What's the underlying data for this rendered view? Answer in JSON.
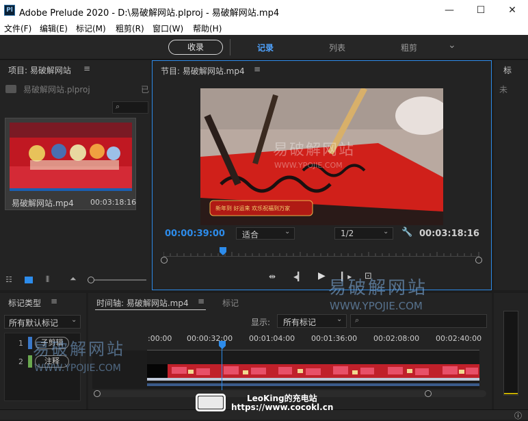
{
  "window": {
    "icon_text": "Pl",
    "title": "Adobe Prelude 2020 - D:\\易破解网站.plproj - 易破解网站.mp4",
    "minimize": "—",
    "maximize": "☐",
    "close": "✕"
  },
  "menu": [
    "文件(F)",
    "编辑(E)",
    "标记(M)",
    "粗剪(R)",
    "窗口(W)",
    "帮助(H)"
  ],
  "workspace": {
    "ingest": "收录",
    "tabs": [
      "记录",
      "列表",
      "粗剪"
    ],
    "active_tab": "记录",
    "more": "⌄"
  },
  "project": {
    "title": "项目: 易破解网站",
    "file": "易破解网站.plproj",
    "status_cut": "已",
    "clip_name": "易破解网站.mp4",
    "clip_duration": "00:03:18:16"
  },
  "monitor": {
    "title": "节目: 易破解网站.mp4",
    "current_time": "00:00:39:00",
    "fit": "适合",
    "resolution": "1/2",
    "duration": "00:03:18:16",
    "watermark_cn": "易破解网站",
    "watermark_url": "WWW.YPOJIE.COM",
    "video_caption": "新年到 好运来 欢乐祝福到万家"
  },
  "right_panel": {
    "title": "标",
    "status": "未"
  },
  "marker_type": {
    "title": "标记类型",
    "filter": "所有默认标记",
    "items": [
      {
        "index": "1",
        "label": "子剪辑"
      },
      {
        "index": "2",
        "label": "注释"
      }
    ]
  },
  "timeline": {
    "tab_active": "时间轴: 易破解网站.mp4",
    "tab_other": "标记",
    "display_label": "显示:",
    "display_value": "所有标记",
    "ruler": [
      ":00:00",
      "00:00:32:00",
      "00:01:04:00",
      "00:01:36:00",
      "00:02:08:00",
      "00:02:40:00"
    ]
  },
  "overlay": {
    "watermark_cn": "易破解网站",
    "watermark_url": "WWW.YPOJIE.COM",
    "credit_line1": "LeoKing的充电站",
    "credit_line2": "https://www.cocokl.cn"
  },
  "colors": {
    "accent": "#2d8ceb",
    "playhead": "#2d8ceb",
    "subclip": "#3a78c9",
    "comment": "#6aa84f",
    "video_red": "#d0201a"
  }
}
